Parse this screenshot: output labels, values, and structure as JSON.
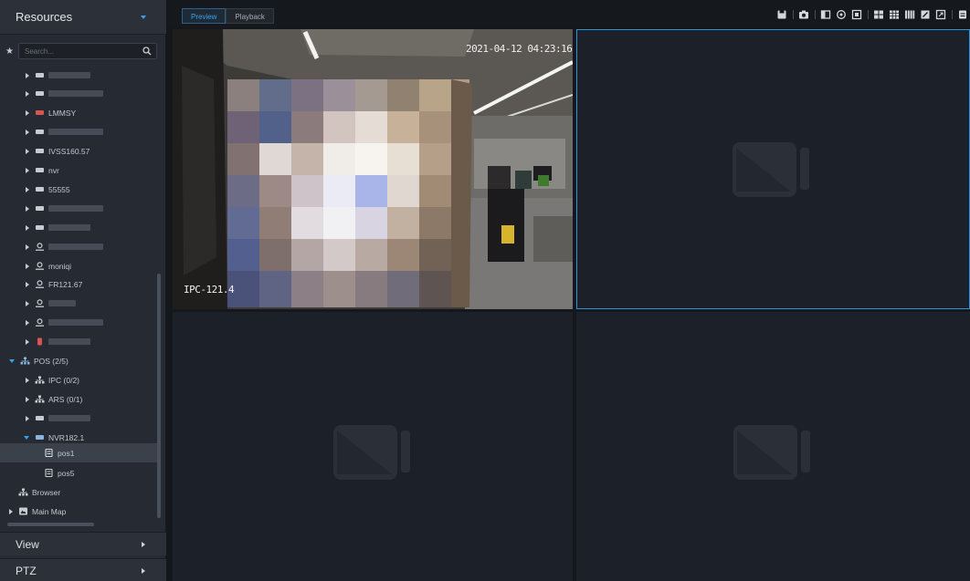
{
  "sidebar": {
    "title": "Resources",
    "search_placeholder": "Search...",
    "tree": {
      "lmmsy": "LMMSY",
      "ivss": "IVSS160.57",
      "nvr": "nvr",
      "s5": "55555",
      "moniqi": "moniqi",
      "fr": "FR121.67",
      "pos_group": "POS (2/5)",
      "ipc": "IPC (0/2)",
      "ars": "ARS (0/1)",
      "nvr182": "NVR182.1",
      "pos1": "pos1",
      "pos5": "pos5",
      "browser": "Browser",
      "main_map": "Main Map"
    },
    "sections": {
      "view": "View",
      "ptz": "PTZ"
    }
  },
  "topbar": {
    "tabs": {
      "preview": "Preview",
      "playback": "Playback"
    }
  },
  "video": {
    "timestamp": "2021-04-12 04:23:16",
    "channel_name": "IPC-121.4"
  },
  "colors": {
    "accent": "#39a0e8",
    "selected_border": "#2a95d8",
    "background": "#14171c"
  }
}
